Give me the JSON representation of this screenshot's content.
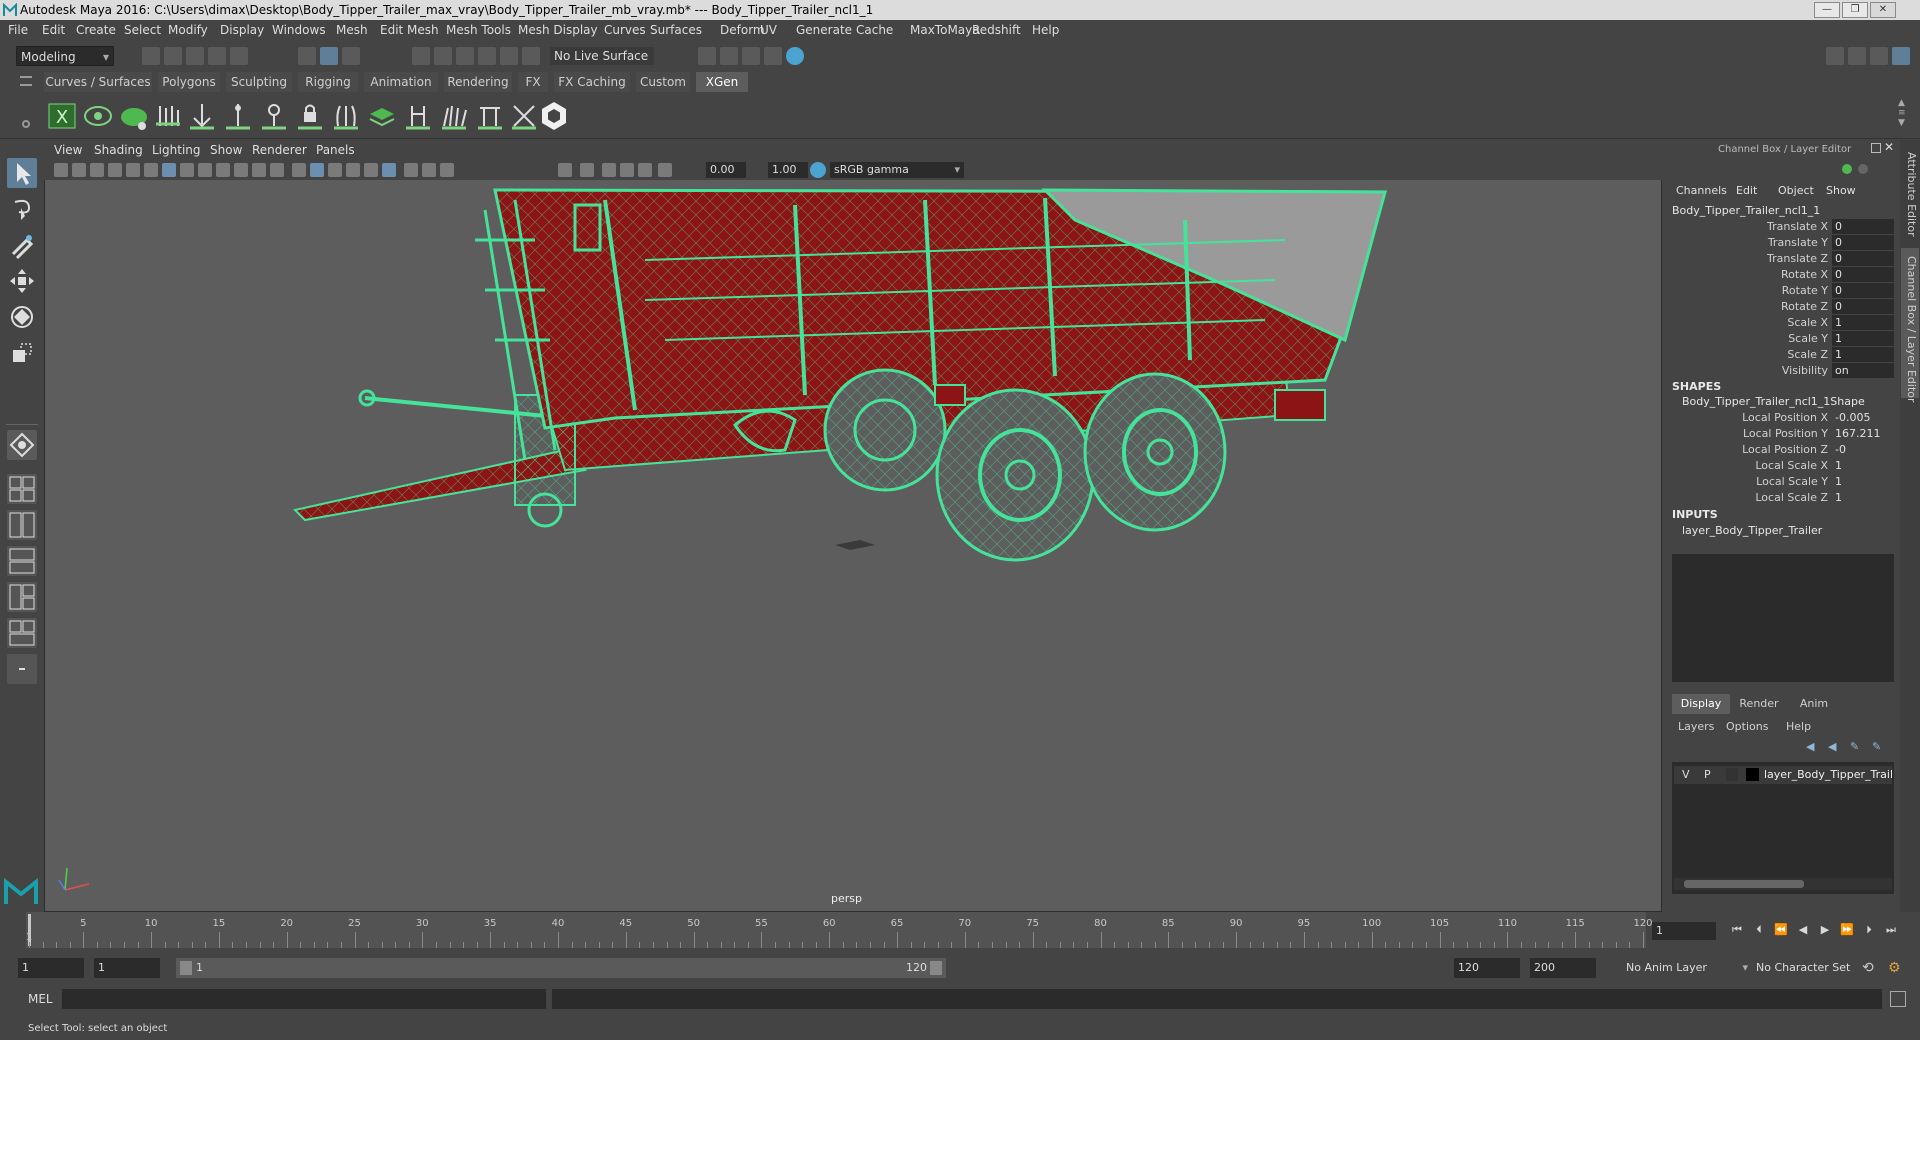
{
  "window": {
    "title": "Autodesk Maya 2016: C:\\Users\\dimax\\Desktop\\Body_Tipper_Trailer_max_vray\\Body_Tipper_Trailer_mb_vray.mb*   ---   Body_Tipper_Trailer_ncl1_1",
    "controls": [
      "—",
      "❐",
      "✕"
    ]
  },
  "menubar": [
    "File",
    "Edit",
    "Create",
    "Select",
    "Modify",
    "Display",
    "Windows",
    "Mesh",
    "Edit Mesh",
    "Mesh Tools",
    "Mesh Display",
    "Curves",
    "Surfaces",
    "Deform",
    "UV",
    "Generate",
    "Cache",
    "MaxToMaya",
    "Redshift",
    "Help"
  ],
  "status": {
    "mode": "Modeling",
    "live_surface": "No Live Surface"
  },
  "shelf": {
    "tabs": [
      "Curves / Surfaces",
      "Polygons",
      "Sculpting",
      "Rigging",
      "Animation",
      "Rendering",
      "FX",
      "FX Caching",
      "Custom",
      "XGen"
    ],
    "active_tab": "XGen",
    "icons": [
      "xgen-window-icon",
      "xgen-preview-icon",
      "xgen-collection-icon",
      "xgen-guides-icon",
      "xgen-add-guide-icon",
      "xgen-sculpt-guide-icon",
      "xgen-length-icon",
      "xgen-lock-icon",
      "xgen-rebuild-icon",
      "xgen-layer-icon",
      "xgen-select-icon",
      "xgen-groom-icon",
      "xgen-cut-icon",
      "xgen-tool-icon",
      "xgen-hex-icon"
    ]
  },
  "viewport": {
    "menu": [
      "View",
      "Shading",
      "Lighting",
      "Show",
      "Renderer",
      "Panels"
    ],
    "exposure": "0.00",
    "gamma": "1.00",
    "color_space": "sRGB gamma",
    "camera": "persp"
  },
  "channel_box": {
    "panel_title": "Channel Box / Layer Editor",
    "menu": [
      "Channels",
      "Edit",
      "Object",
      "Show"
    ],
    "object_name": "Body_Tipper_Trailer_ncl1_1",
    "attributes": [
      {
        "label": "Translate X",
        "value": "0"
      },
      {
        "label": "Translate Y",
        "value": "0"
      },
      {
        "label": "Translate Z",
        "value": "0"
      },
      {
        "label": "Rotate X",
        "value": "0"
      },
      {
        "label": "Rotate Y",
        "value": "0"
      },
      {
        "label": "Rotate Z",
        "value": "0"
      },
      {
        "label": "Scale X",
        "value": "1"
      },
      {
        "label": "Scale Y",
        "value": "1"
      },
      {
        "label": "Scale Z",
        "value": "1"
      },
      {
        "label": "Visibility",
        "value": "on"
      }
    ],
    "shapes_header": "SHAPES",
    "shape_name": "Body_Tipper_Trailer_ncl1_1Shape",
    "shape_attributes": [
      {
        "label": "Local Position X",
        "value": "-0.005"
      },
      {
        "label": "Local Position Y",
        "value": "167.211"
      },
      {
        "label": "Local Position Z",
        "value": "-0"
      },
      {
        "label": "Local Scale X",
        "value": "1"
      },
      {
        "label": "Local Scale Y",
        "value": "1"
      },
      {
        "label": "Local Scale Z",
        "value": "1"
      }
    ],
    "inputs_header": "INPUTS",
    "input_name": "layer_Body_Tipper_Trailer"
  },
  "layer_editor": {
    "tabs": [
      "Display",
      "Render",
      "Anim"
    ],
    "active_tab": "Display",
    "menu": [
      "Layers",
      "Options",
      "Help"
    ],
    "layer": {
      "v": "V",
      "p": "P",
      "name": "layer_Body_Tipper_Trailer"
    }
  },
  "side_tabs": [
    "Attribute Editor",
    "Channel Box / Layer Editor"
  ],
  "timeline": {
    "ticks": [
      "5",
      "10",
      "15",
      "20",
      "25",
      "30",
      "35",
      "40",
      "45",
      "50",
      "55",
      "60",
      "65",
      "70",
      "75",
      "80",
      "85",
      "90",
      "95",
      "100",
      "105",
      "110",
      "115",
      "120"
    ],
    "start_label": "1",
    "current_frame": "1"
  },
  "range": {
    "start": "1",
    "playback_start": "1",
    "slider_start": "1",
    "slider_end": "120",
    "playback_end": "120",
    "end": "200",
    "anim_layer": "No Anim Layer",
    "character_set": "No Character Set"
  },
  "command_line": {
    "label": "MEL"
  },
  "help_line": "Select Tool: select an object",
  "colors": {
    "selection_wire": "#45e39a",
    "trailer_body": "#8c1414",
    "viewport_bg": "#5d5d5d"
  }
}
